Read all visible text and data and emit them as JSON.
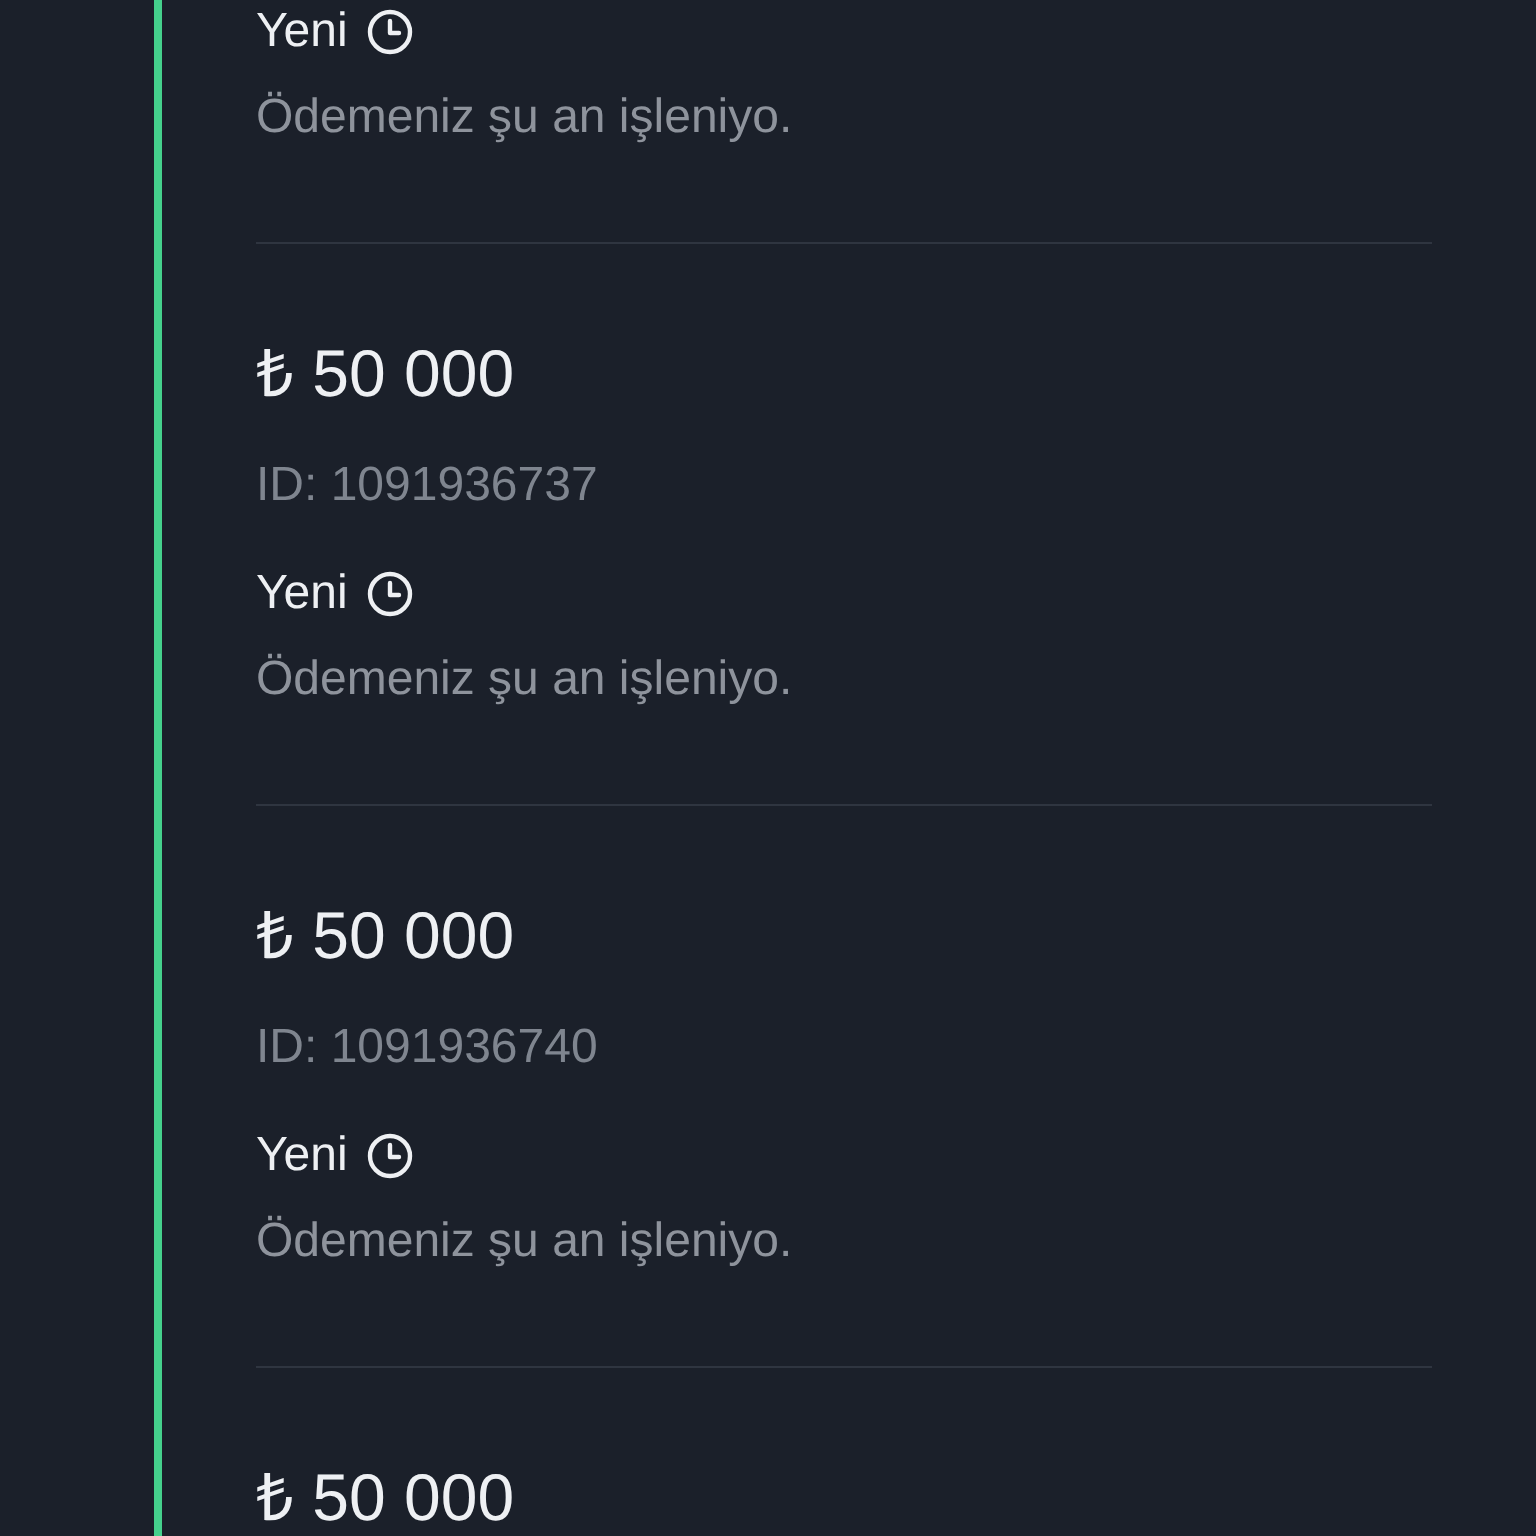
{
  "payments": [
    {
      "status": "Yeni",
      "message": "Ödemeniz şu an işleniyo."
    },
    {
      "amount": "₺ 50 000",
      "id": "ID: 1091936737",
      "status": "Yeni",
      "message": "Ödemeniz şu an işleniyo."
    },
    {
      "amount": "₺ 50 000",
      "id": "ID: 1091936740",
      "status": "Yeni",
      "message": "Ödemeniz şu an işleniyo."
    },
    {
      "amount": "₺ 50 000"
    }
  ]
}
